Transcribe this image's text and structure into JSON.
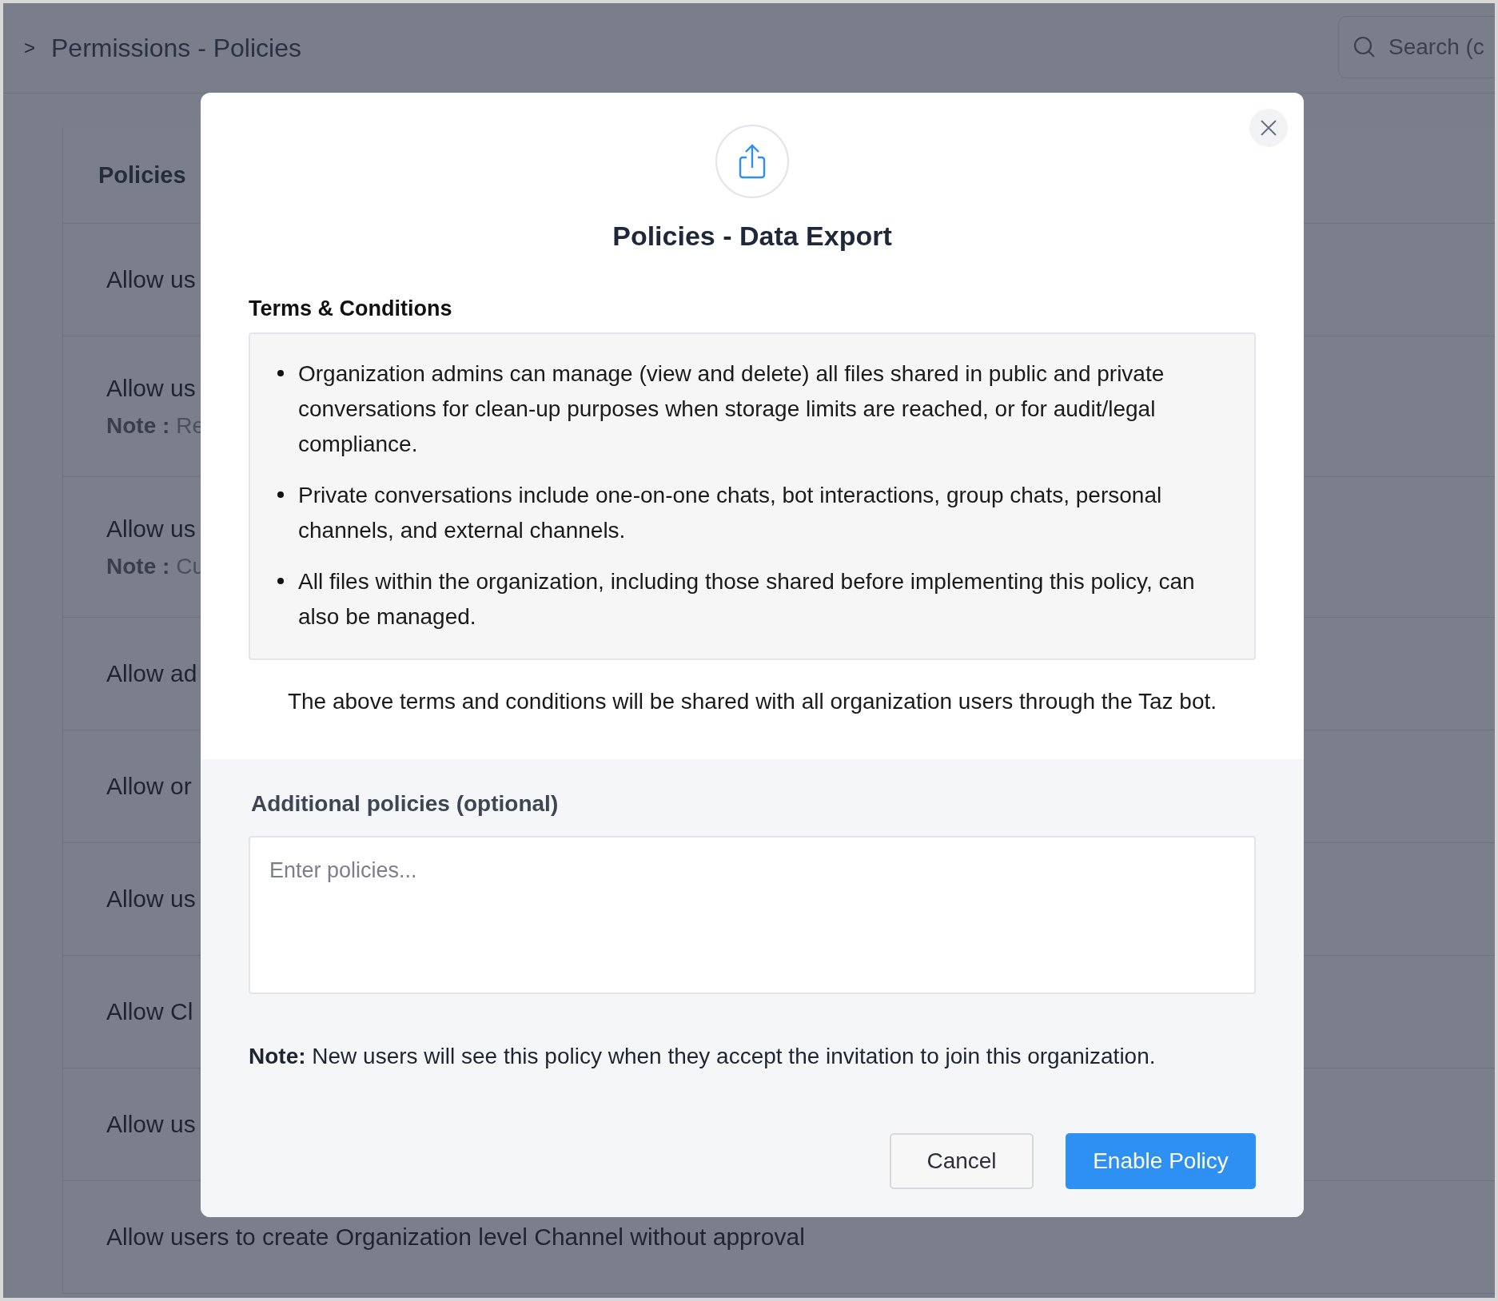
{
  "header": {
    "breadcrumb_separator": ">",
    "title": "Permissions - Policies",
    "search": {
      "placeholder": "Search (c"
    }
  },
  "policies_panel": {
    "heading": "Policies",
    "rows": [
      {
        "text": "Allow us"
      },
      {
        "text": "Allow us",
        "note_label": "Note :",
        "note": "Re"
      },
      {
        "text": "Allow us",
        "note_label": "Note :",
        "note": "Cu"
      },
      {
        "text": "Allow ad"
      },
      {
        "text": "Allow or"
      },
      {
        "text": "Allow us"
      },
      {
        "text": "Allow Cl"
      },
      {
        "text": "Allow us"
      },
      {
        "text": "Allow users to create Organization level Channel without approval"
      }
    ]
  },
  "dialog": {
    "title": "Policies - Data Export",
    "terms_heading": "Terms & Conditions",
    "terms": [
      "Organization admins can manage (view and delete) all files shared in public and private conversations for clean-up purposes when storage limits are reached, or for audit/legal compliance.",
      "Private conversations include one-on-one chats, bot interactions, group chats, personal channels, and external channels.",
      "All files within the organization, including those shared before implementing this policy, can also be managed."
    ],
    "shared_notice": "The above terms and conditions will be shared with all organization users through the Taz bot.",
    "additional_label": "Additional policies (optional)",
    "additional_field": {
      "placeholder": "Enter policies..."
    },
    "note": "**Note:** New users will see this policy when they accept the invitation to join this organization.",
    "buttons": [
      {
        "label": "Cancel",
        "kind": "secondary"
      },
      {
        "label": "Enable Policy",
        "kind": "primary"
      }
    ]
  }
}
